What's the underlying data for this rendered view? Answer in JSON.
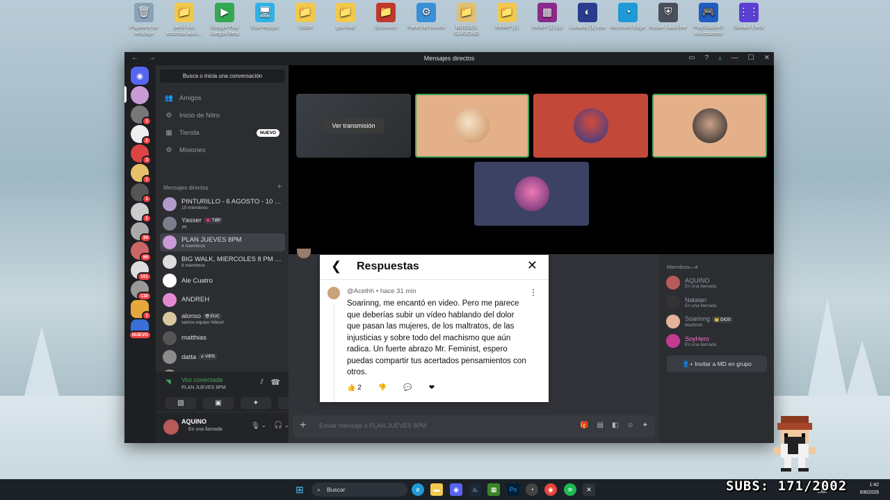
{
  "desktop_icons": [
    {
      "label": "Papelera de reciclaje",
      "color": "#8aa3b8",
      "glyph": "🗑"
    },
    {
      "label": "perfil cos escenas autu...",
      "color": "#f2c94c",
      "glyph": "📁"
    },
    {
      "label": "Google Play Juegos Beta",
      "color": "#35a853",
      "glyph": "▶"
    },
    {
      "label": "Este equipo",
      "color": "#2fb3e6",
      "glyph": "🖥"
    },
    {
      "label": "USER",
      "color": "#f2c94c",
      "glyph": "📁"
    },
    {
      "label": "gta mod",
      "color": "#f2c94c",
      "glyph": "📁"
    },
    {
      "label": "Escritorio",
      "color": "#c0392b",
      "glyph": "📁"
    },
    {
      "label": "Panel de control",
      "color": "#3a8fd9",
      "glyph": "⚙"
    },
    {
      "label": "BOSSES SL4SONG",
      "color": "#e0c070",
      "glyph": "📁"
    },
    {
      "label": "HKMP (1)",
      "color": "#f2c94c",
      "glyph": "📁"
    },
    {
      "label": "HKMP (1).zip",
      "color": "#8b2a8a",
      "glyph": "▦"
    },
    {
      "label": "Lunarity (1).exe",
      "color": "#2b3c8f",
      "glyph": "◐"
    },
    {
      "label": "Microsoft Edge",
      "color": "#1f9ad6",
      "glyph": "◔"
    },
    {
      "label": "Hytale Launcher",
      "color": "#4a4f5a",
      "glyph": "⛨"
    },
    {
      "label": "PlayStation® Accessories",
      "color": "#1f5cbf",
      "glyph": "🎮"
    },
    {
      "label": "Stream Deck",
      "color": "#5b3fd6",
      "glyph": "⋮⋮"
    }
  ],
  "window": {
    "title": "Mensajes directos",
    "nav": "← →"
  },
  "sidebar": {
    "search_label": "Busca o inicia una conversación",
    "nav": [
      {
        "label": "Amigos",
        "icon": "👥"
      },
      {
        "label": "Inicio de Nitro",
        "icon": "⚙"
      },
      {
        "label": "Tienda",
        "icon": "▦",
        "badge": "NUEVO"
      },
      {
        "label": "Misiones",
        "icon": "⚙"
      }
    ],
    "dm_header": "Mensajes directos",
    "dms": [
      {
        "name": "PINTURILLO - 6 AGOSTO - 10 P...",
        "sub": "10 miembros",
        "color": "#b49ac9"
      },
      {
        "name": "Yasser",
        "tag": "💗 TØP",
        "sub": "🎮",
        "color": "#7a7f8c"
      },
      {
        "name": "PLAN JUEVES 8PM",
        "sub": "4 miembros",
        "color": "#c99bd6"
      },
      {
        "name": "BIG WALK, MIERCOLES 8 PM P...",
        "sub": "8 miembros",
        "color": "#ddd"
      },
      {
        "name": "Ale Cuatro",
        "sub": "",
        "color": "#fff"
      },
      {
        "name": "ANDREH",
        "sub": "",
        "color": "#e28ad0"
      },
      {
        "name": "alonso",
        "tag": "😎 EUC",
        "sub": "vamos equipo hibisol",
        "color": "#d9c7a0"
      },
      {
        "name": "matthias",
        "sub": "",
        "color": "#555"
      },
      {
        "name": "datta",
        "tag": "⚔ VIPS",
        "sub": "",
        "color": "#8c8c8c"
      },
      {
        "name": "KAR",
        "sub": "",
        "color": "#9e8a7e"
      }
    ]
  },
  "rail_badges": [
    "1",
    "2",
    "3",
    "1",
    "1",
    "1",
    "39",
    "69",
    "101",
    "130",
    "1",
    "NUEVO"
  ],
  "voice": {
    "status": "Voz conectada",
    "channel": "PLAN JUEVES 8PM"
  },
  "user": {
    "name": "AQUINO",
    "status": "En una llamada"
  },
  "stage": {
    "stream_button": "Ver transmisión"
  },
  "composer": {
    "placeholder": "Enviar mensaje a PLAN JUEVES 8PM"
  },
  "members": {
    "header": "Miembros—4",
    "list": [
      {
        "name": "AQUINO",
        "sub": "En una llamada",
        "color": "#b85a5a"
      },
      {
        "name": "Natalan",
        "sub": "En una llamada",
        "color": "#333"
      },
      {
        "name": "Soarinng",
        "tag": "👑 DIOS",
        "sub": "Modrinth",
        "color": "#e3b49a"
      },
      {
        "name": "SoyHero",
        "sub": "En una llamada",
        "color": "#c33b8f"
      }
    ],
    "invite_label": "Invitar a MD en grupo"
  },
  "replies": {
    "title": "Respuestas",
    "author": "@Acethh",
    "time": "hace 31 min",
    "text": "Soarinng, me encantó en video. Pero me parece que deberías subir un vídeo hablando del dolor que pasan las mujeres, de los maltratos, de las injusticias y sobre todo del machismo que aún radica. Un fuerte abrazo Mr. Feminist, espero puedas compartir tus acertados pensamientos con otros.",
    "likes": "2"
  },
  "taskbar": {
    "search_label": "Buscar",
    "tray_lang": "ESP LAA",
    "time": "1:42",
    "date": "6/8/2026"
  },
  "overlay": {
    "subs": "SUBS: 171/2002"
  }
}
